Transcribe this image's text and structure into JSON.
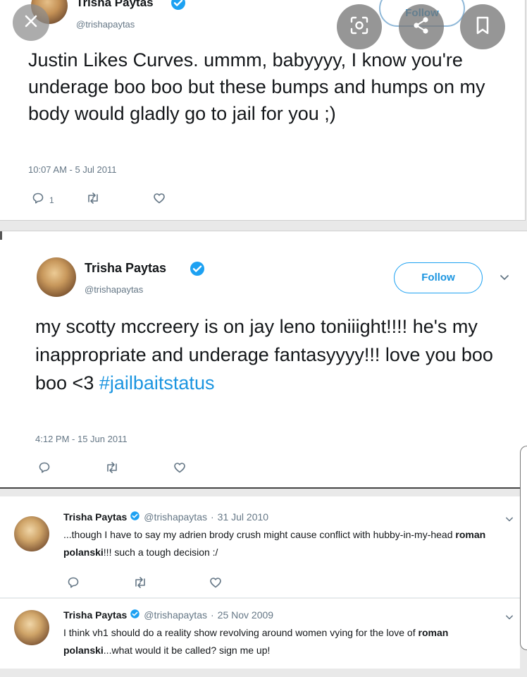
{
  "colors": {
    "link_blue": "#1b95e0",
    "verified_blue": "#1da1f2",
    "secondary_text": "#657786",
    "primary_text": "#14171a"
  },
  "overlay": {
    "close_icon": "close-icon",
    "lens_icon": "lens-icon",
    "share_icon": "share-icon",
    "save_icon": "bookmark-icon"
  },
  "tweet1": {
    "name": "Trisha Paytas",
    "handle": "@trishapaytas",
    "follow_label": "Follow",
    "text": "Justin Likes Curves. ummm, babyyyy, I know you're underage boo boo but these bumps and humps on my body would gladly go to jail for you ;)",
    "timestamp": "10:07 AM - 5 Jul 2011",
    "reply_count": "1"
  },
  "tweet2": {
    "name": "Trisha Paytas",
    "handle": "@trishapaytas",
    "follow_label": "Follow",
    "text": "my scotty mccreery is on jay leno toniiight!!!! he's my inappropriate and underage fantasyyyy!!! love you boo boo <3",
    "hashtag": "#jailbaitstatus",
    "timestamp": "4:12 PM - 15 Jun 2011"
  },
  "tweet3": {
    "name": "Trisha Paytas",
    "handle": "@trishapaytas",
    "separator": "·",
    "date": "31 Jul 2010",
    "text_before": "...though I have to say my adrien brody crush might cause conflict with hubby-in-my-head ",
    "text_bold": "roman polanski",
    "text_after": "!!! such a tough decision :/"
  },
  "tweet4": {
    "name": "Trisha Paytas",
    "handle": "@trishapaytas",
    "separator": "·",
    "date": "25 Nov 2009",
    "text_before": "I think vh1 should do a reality show revolving around women vying for the love of ",
    "text_bold": "roman polanski",
    "text_after": "...what would it be called? sign me up!"
  }
}
